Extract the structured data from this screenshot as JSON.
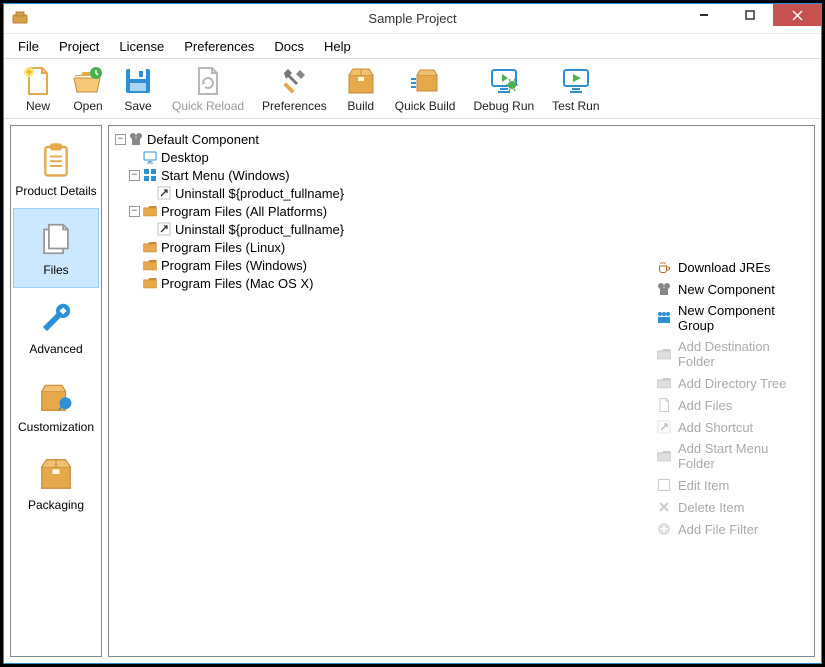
{
  "window": {
    "title": "Sample Project"
  },
  "menubar": [
    "File",
    "Project",
    "License",
    "Preferences",
    "Docs",
    "Help"
  ],
  "toolbar": [
    {
      "key": "new",
      "label": "New",
      "icon": "doc-new"
    },
    {
      "key": "open",
      "label": "Open",
      "icon": "folder-open"
    },
    {
      "key": "save",
      "label": "Save",
      "icon": "disk"
    },
    {
      "key": "quickreload",
      "label": "Quick Reload",
      "icon": "reload",
      "disabled": true
    },
    {
      "key": "preferences",
      "label": "Preferences",
      "icon": "wrench-cross"
    },
    {
      "key": "build",
      "label": "Build",
      "icon": "box"
    },
    {
      "key": "quickbuild",
      "label": "Quick Build",
      "icon": "box-fast"
    },
    {
      "key": "debugrun",
      "label": "Debug Run",
      "icon": "monitor-bug"
    },
    {
      "key": "testrun",
      "label": "Test Run",
      "icon": "monitor-play"
    }
  ],
  "sidebar": [
    {
      "key": "productdetails",
      "label": "Product Details",
      "icon": "clipboard"
    },
    {
      "key": "files",
      "label": "Files",
      "icon": "files",
      "selected": true
    },
    {
      "key": "advanced",
      "label": "Advanced",
      "icon": "wrench"
    },
    {
      "key": "customization",
      "label": "Customization",
      "icon": "box-wrench"
    },
    {
      "key": "packaging",
      "label": "Packaging",
      "icon": "box"
    }
  ],
  "tree": [
    {
      "depth": 0,
      "expander": "-",
      "icon": "component",
      "label": "Default Component"
    },
    {
      "depth": 1,
      "expander": " ",
      "icon": "desktop",
      "label": "Desktop"
    },
    {
      "depth": 1,
      "expander": "-",
      "icon": "startmenu",
      "label": "Start Menu (Windows)"
    },
    {
      "depth": 2,
      "expander": " ",
      "icon": "shortcut",
      "label": "Uninstall ${product_fullname}"
    },
    {
      "depth": 1,
      "expander": "-",
      "icon": "folder",
      "label": "Program Files (All Platforms)"
    },
    {
      "depth": 2,
      "expander": " ",
      "icon": "shortcut",
      "label": "Uninstall ${product_fullname}"
    },
    {
      "depth": 1,
      "expander": " ",
      "icon": "folder",
      "label": "Program Files (Linux)"
    },
    {
      "depth": 1,
      "expander": " ",
      "icon": "folder",
      "label": "Program Files (Windows)"
    },
    {
      "depth": 1,
      "expander": " ",
      "icon": "folder",
      "label": "Program Files (Mac OS X)"
    }
  ],
  "actions": [
    {
      "key": "downloadjres",
      "label": "Download JREs",
      "icon": "coffee"
    },
    {
      "key": "newcomponent",
      "label": "New Component",
      "icon": "component"
    },
    {
      "key": "newcomponentgroup",
      "label": "New Component Group",
      "icon": "component-group"
    },
    {
      "key": "adddestfolder",
      "label": "Add Destination Folder",
      "icon": "folder-gray",
      "disabled": true
    },
    {
      "key": "adddirtree",
      "label": "Add Directory Tree",
      "icon": "folder-gray",
      "disabled": true
    },
    {
      "key": "addfiles",
      "label": "Add Files",
      "icon": "doc-gray",
      "disabled": true
    },
    {
      "key": "addshortcut",
      "label": "Add Shortcut",
      "icon": "shortcut-gray",
      "disabled": true
    },
    {
      "key": "addstartmenufolder",
      "label": "Add Start Menu Folder",
      "icon": "folder-gray",
      "disabled": true
    },
    {
      "key": "edititem",
      "label": "Edit Item",
      "icon": "edit-gray",
      "disabled": true
    },
    {
      "key": "deleteitem",
      "label": "Delete Item",
      "icon": "delete-gray",
      "disabled": true
    },
    {
      "key": "addfilefilter",
      "label": "Add File Filter",
      "icon": "plus-gray",
      "disabled": true
    }
  ]
}
